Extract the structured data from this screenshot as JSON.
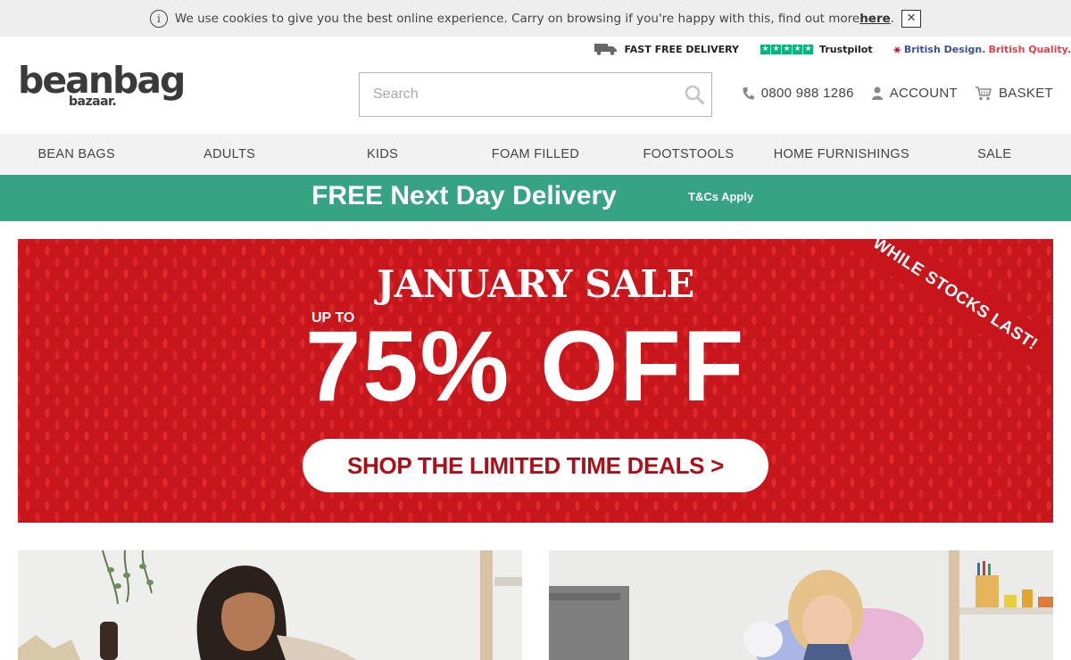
{
  "cookie": {
    "text": "We use cookies to give you the best online experience. Carry on browsing if you're happy with this, find out more ",
    "link": "here",
    "after": ".",
    "close": "✕"
  },
  "usp": {
    "delivery": "FAST FREE DELIVERY",
    "trustpilot": "Trustpilot",
    "british_design": "British Design.",
    "british_quality": "British Quality."
  },
  "logo": {
    "main": "beanbag",
    "sub": "bazaar."
  },
  "search": {
    "placeholder": "Search"
  },
  "header": {
    "phone": "0800 988 1286",
    "account": "ACCOUNT",
    "basket": "BASKET"
  },
  "nav": [
    "BEAN BAGS",
    "ADULTS",
    "KIDS",
    "FOAM FILLED",
    "FOOTSTOOLS",
    "HOME FURNISHINGS",
    "SALE"
  ],
  "delivery_bar": {
    "headline": "FREE Next Day Delivery",
    "terms": "T&Cs Apply"
  },
  "hero": {
    "title": "JANUARY SALE",
    "up_to": "UP TO",
    "offer": "75% OFF",
    "cta": "SHOP THE LIMITED TIME DEALS  >",
    "ribbon": "WHILE STOCKS LAST!"
  },
  "colors": {
    "green": "#36a382",
    "red": "#c8171c",
    "trustpilot": "#00b67a"
  },
  "icons": [
    "info-icon",
    "close-icon",
    "truck-icon",
    "star-icon",
    "union-flag-icon",
    "search-icon",
    "phone-icon",
    "user-icon",
    "basket-icon"
  ]
}
